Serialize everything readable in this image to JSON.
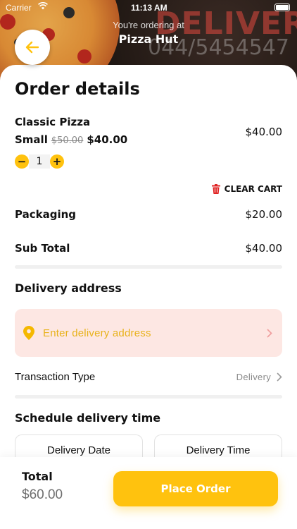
{
  "status_bar": {
    "carrier": "Carrier",
    "time": "11:13 AM"
  },
  "header": {
    "ordering_at": "You're ordering at",
    "restaurant": "Pizza Hut",
    "banner_text": "DELIVERY",
    "banner_phone": "044/5454547"
  },
  "order": {
    "title": "Order details",
    "item": {
      "name": "Classic Pizza",
      "size": "Small",
      "old_price": "$50.00",
      "new_price": "$40.00",
      "line_total": "$40.00",
      "quantity": "1",
      "minus": "−",
      "plus": "+"
    },
    "clear_cart": "CLEAR CART",
    "packaging_label": "Packaging",
    "packaging_value": "$20.00",
    "subtotal_label": "Sub Total",
    "subtotal_value": "$40.00"
  },
  "delivery": {
    "section_title": "Delivery address",
    "address_placeholder": "Enter delivery address",
    "transaction_label": "Transaction Type",
    "transaction_value": "Delivery"
  },
  "schedule": {
    "section_title": "Schedule delivery time",
    "date_label": "Delivery Date",
    "time_label": "Delivery Time"
  },
  "footer": {
    "total_label": "Total",
    "total_value": "$60.00",
    "place_order": "Place Order"
  },
  "colors": {
    "accent": "#FFC20E",
    "danger": "#E02424",
    "address_bg": "#FDE7E3",
    "address_text": "#E8B21A"
  },
  "icons": {
    "back": "arrow-left-icon",
    "trash": "trash-icon",
    "location": "location-pin-icon",
    "chevron": "chevron-right-icon"
  }
}
